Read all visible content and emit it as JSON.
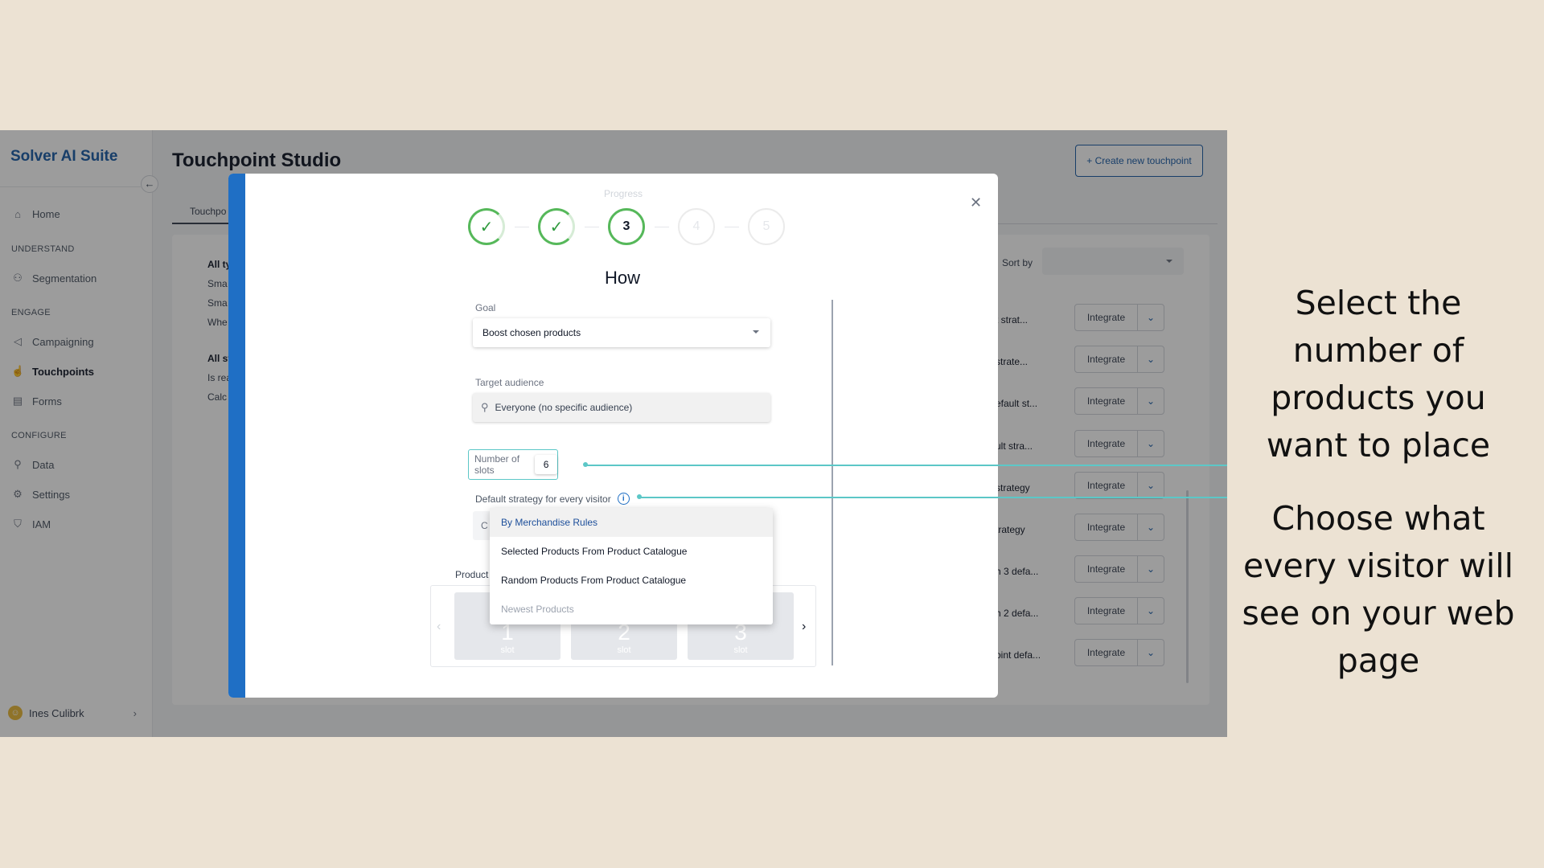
{
  "app": {
    "brand": "Solver AI Suite"
  },
  "sidebar": {
    "items": [
      {
        "label": "Home",
        "icon": "home-icon"
      },
      {
        "section": "UNDERSTAND"
      },
      {
        "label": "Segmentation",
        "icon": "users-icon"
      },
      {
        "section": "ENGAGE"
      },
      {
        "label": "Campaigning",
        "icon": "megaphone-icon"
      },
      {
        "label": "Touchpoints",
        "icon": "hand-pointer-icon",
        "active": true
      },
      {
        "label": "Forms",
        "icon": "clipboard-icon"
      },
      {
        "section": "CONFIGURE"
      },
      {
        "label": "Data",
        "icon": "data-nodes-icon"
      },
      {
        "label": "Settings",
        "icon": "sliders-icon"
      },
      {
        "label": "IAM",
        "icon": "shield-icon"
      }
    ],
    "user": "Ines Culibrk"
  },
  "main": {
    "title": "Touchpoint Studio",
    "create_button": "+ Create new touchpoint",
    "tab": "Touchpo",
    "filters": [
      "All ty",
      "Sma",
      "Sma",
      "Whe",
      "All st",
      "Is rea",
      "Calc"
    ],
    "sort_label": "Sort by",
    "rows": [
      "t strat...",
      "strate...",
      "efault st...",
      "ult stra...",
      "strategy",
      "trategy",
      "h 3 defa...",
      "h 2 defa...",
      "oint defa..."
    ],
    "integrate_label": "Integrate"
  },
  "modal": {
    "progress_label": "Progress",
    "steps": [
      {
        "label": "",
        "state": "done"
      },
      {
        "label": "",
        "state": "done"
      },
      {
        "label": "3",
        "state": "current"
      },
      {
        "label": "4",
        "state": "todo"
      },
      {
        "label": "5",
        "state": "todo"
      }
    ],
    "heading": "How",
    "goal": {
      "label": "Goal",
      "value": "Boost chosen products"
    },
    "target_audience": {
      "label": "Target audience",
      "value": "Everyone (no specific audience)"
    },
    "slots": {
      "label": "Number of slots",
      "value": "6"
    },
    "strategy": {
      "label": "Default strategy for every visitor",
      "options": [
        "By Merchandise Rules",
        "Selected Products From Product Catalogue",
        "Random Products From Product Catalogue",
        "Newest Products"
      ],
      "selected_index": 0
    },
    "products_label": "Product",
    "slot_cards": [
      {
        "num": "1",
        "sub": "slot"
      },
      {
        "num": "2",
        "sub": "slot"
      },
      {
        "num": "3",
        "sub": "slot"
      }
    ]
  },
  "annotations": {
    "slots": "Select the number of products you want to place",
    "strategy": "Choose what every visitor will see on your web page"
  },
  "colors": {
    "background": "#ece2d3",
    "brand": "#1c5ea8",
    "accent_band": "#1f6fc5",
    "progress_green": "#56b85a",
    "callout": "#5cc7c7"
  }
}
